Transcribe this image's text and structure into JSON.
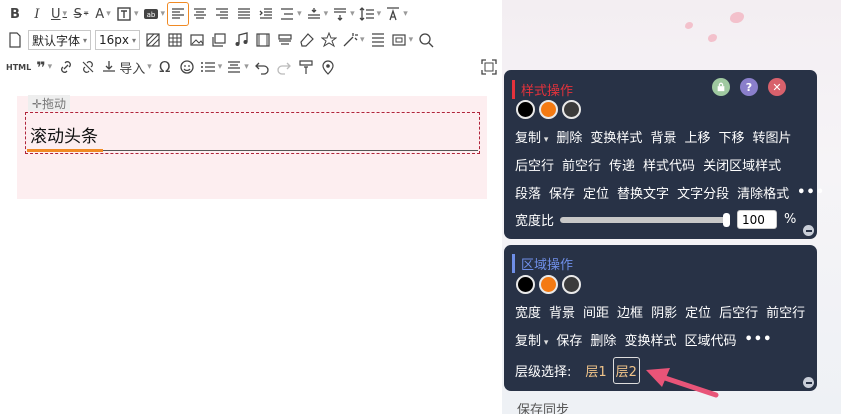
{
  "toolbar": {
    "font_family": "默认字体",
    "font_size": "16px",
    "import_label": "导入",
    "html_label": "HTML"
  },
  "editor": {
    "drag_label": "✛拖动",
    "headline": "滚动头条",
    "colors": {
      "accent": "#f08a24",
      "block_bg": "#fdeef0",
      "dashed_border": "#b0243a"
    }
  },
  "style_panel": {
    "title": "样式操作",
    "swatches": [
      "#000000",
      "#f47a12",
      "#3b3b3b"
    ],
    "rows": [
      [
        "复制",
        "删除",
        "变换样式",
        "背景",
        "上移",
        "下移",
        "转图片"
      ],
      [
        "后空行",
        "前空行",
        "传递",
        "样式代码",
        "关闭区域样式"
      ],
      [
        "段落",
        "保存",
        "定位",
        "替换文字",
        "文字分段",
        "清除格式",
        "•••"
      ]
    ],
    "width_label": "宽度比",
    "width_value": "100",
    "width_unit": "%",
    "width_ratio": 1.0
  },
  "area_panel": {
    "title": "区域操作",
    "swatches": [
      "#000000",
      "#f47a12",
      "#3b3b3b"
    ],
    "row1": [
      "宽度",
      "背景",
      "间距",
      "边框",
      "阴影",
      "定位",
      "后空行",
      "前空行"
    ],
    "row2": [
      "复制",
      "保存",
      "删除",
      "变换样式",
      "区域代码",
      "•••"
    ],
    "layer_label": "层级选择:",
    "layers": [
      "层1",
      "层2"
    ]
  },
  "footer": {
    "sync_label": "保存同步"
  },
  "colors": {
    "panel_bg": "#283246",
    "style_title": "#e4323c",
    "area_title": "#6f8fe8",
    "arrow": "#e85478"
  }
}
